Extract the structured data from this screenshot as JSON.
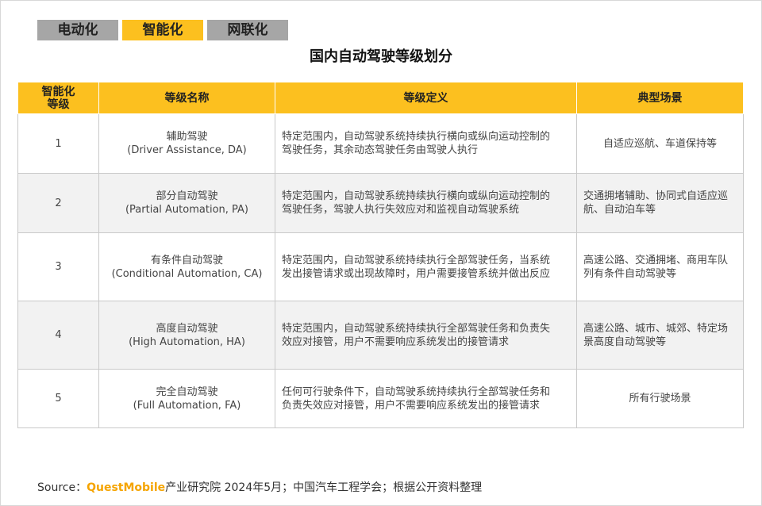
{
  "tabs": [
    {
      "label": "电动化",
      "active": false
    },
    {
      "label": "智能化",
      "active": true
    },
    {
      "label": "网联化",
      "active": false
    }
  ],
  "title": "国内自动驾驶等级划分",
  "table": {
    "headers": {
      "level_line1": "智能化",
      "level_line2": "等级",
      "name": "等级名称",
      "definition": "等级定义",
      "scene": "典型场景"
    },
    "rows": [
      {
        "level": "1",
        "name_cn": "辅助驾驶",
        "name_en": "(Driver Assistance, DA)",
        "def_line1": "特定范围内，自动驾驶系统持续执行横向或纵向运动控制的",
        "def_line2": "驾驶任务，其余动态驾驶任务由驾驶人执行",
        "scene_line1": "自适应巡航、车道保持等",
        "scene_line2": ""
      },
      {
        "level": "2",
        "name_cn": "部分自动驾驶",
        "name_en": "(Partial Automation, PA)",
        "def_line1": "特定范围内，自动驾驶系统持续执行横向或纵向运动控制的",
        "def_line2": "驾驶任务，驾驶人执行失效应对和监视自动驾驶系统",
        "scene_line1": "交通拥堵辅助、协同式自适应巡",
        "scene_line2": "航、自动泊车等"
      },
      {
        "level": "3",
        "name_cn": "有条件自动驾驶",
        "name_en": "(Conditional Automation, CA)",
        "def_line1": "特定范围内，自动驾驶系统持续执行全部驾驶任务，当系统",
        "def_line2": "发出接管请求或出现故障时，用户需要接管系统并做出反应",
        "scene_line1": "高速公路、交通拥堵、商用车队",
        "scene_line2": "列有条件自动驾驶等"
      },
      {
        "level": "4",
        "name_cn": "高度自动驾驶",
        "name_en": "(High Automation, HA)",
        "def_line1": "特定范围内，自动驾驶系统持续执行全部驾驶任务和负责失",
        "def_line2": "效应对接管，用户不需要响应系统发出的接管请求",
        "scene_line1": "高速公路、城市、城郊、特定场",
        "scene_line2": "景高度自动驾驶等"
      },
      {
        "level": "5",
        "name_cn": "完全自动驾驶",
        "name_en": "(Full Automation, FA)",
        "def_line1": "任何可行驶条件下，自动驾驶系统持续执行全部驾驶任务和",
        "def_line2": "负责失效应对接管，用户不需要响应系统发出的接管请求",
        "scene_line1": "所有行驶场景",
        "scene_line2": ""
      }
    ]
  },
  "source": {
    "prefix": "Source：",
    "brand": "QuestMobile",
    "text": "产业研究院 2024年5月；中国汽车工程学会；根据公开资料整理"
  },
  "colors": {
    "accent": "#fcc01f",
    "tab_grey": "#a6a6a6",
    "brand": "#f5a400",
    "row_alt": "#f2f2f2"
  }
}
